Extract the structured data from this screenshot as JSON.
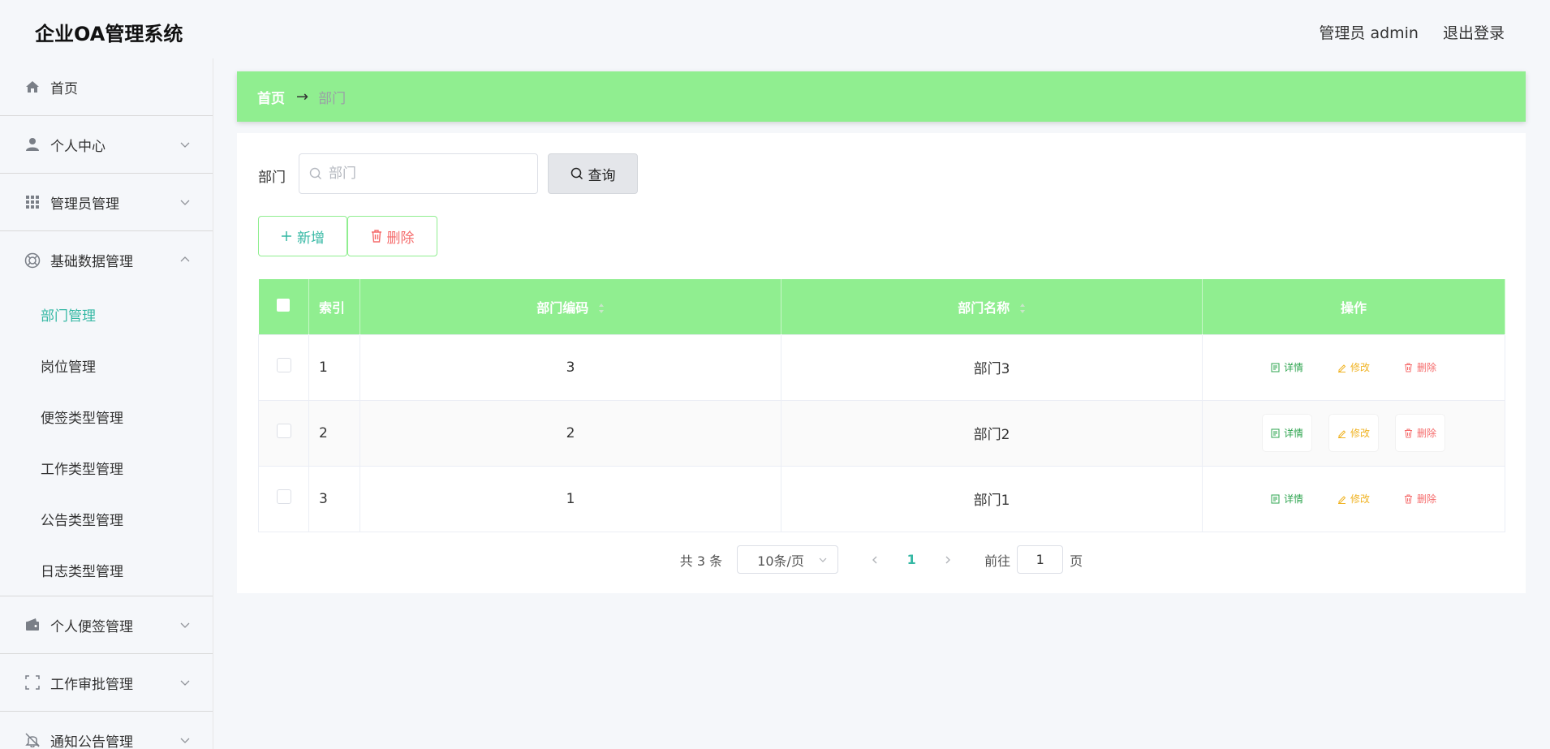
{
  "header": {
    "title": "企业OA管理系统",
    "user_label": "管理员 admin",
    "logout_label": "退出登录"
  },
  "sidebar": {
    "items": [
      {
        "label": "首页",
        "icon": "home-icon"
      },
      {
        "label": "个人中心",
        "icon": "user-icon"
      },
      {
        "label": "管理员管理",
        "icon": "grid-icon"
      },
      {
        "label": "基础数据管理",
        "icon": "lifebuoy-icon"
      },
      {
        "label": "个人便签管理",
        "icon": "wallet-icon"
      },
      {
        "label": "工作审批管理",
        "icon": "frame-icon"
      },
      {
        "label": "通知公告管理",
        "icon": "bell-icon"
      }
    ],
    "submenu": [
      {
        "label": "部门管理"
      },
      {
        "label": "岗位管理"
      },
      {
        "label": "便签类型管理"
      },
      {
        "label": "工作类型管理"
      },
      {
        "label": "公告类型管理"
      },
      {
        "label": "日志类型管理"
      }
    ]
  },
  "breadcrumb": {
    "home": "首页",
    "current": "部门"
  },
  "search": {
    "label": "部门",
    "placeholder": "部门",
    "button": "查询"
  },
  "actions": {
    "add": "新增",
    "delete": "删除"
  },
  "table": {
    "headers": {
      "index": "索引",
      "code": "部门编码",
      "name": "部门名称",
      "ops": "操作"
    },
    "rows": [
      {
        "index": "1",
        "code": "3",
        "name": "部门3"
      },
      {
        "index": "2",
        "code": "2",
        "name": "部门2"
      },
      {
        "index": "3",
        "code": "1",
        "name": "部门1"
      }
    ],
    "ops": {
      "detail": "详情",
      "edit": "修改",
      "remove": "删除"
    }
  },
  "pagination": {
    "total": "共 3 条",
    "page_size": "10条/页",
    "current_page": "1",
    "goto_label": "前往",
    "goto_value": "1",
    "page_suffix": "页"
  },
  "colors": {
    "accent": "#90ee90",
    "active_text": "#35b8a4",
    "danger": "#f56c6c",
    "warning": "#f0b323",
    "success": "#2ea44f"
  }
}
